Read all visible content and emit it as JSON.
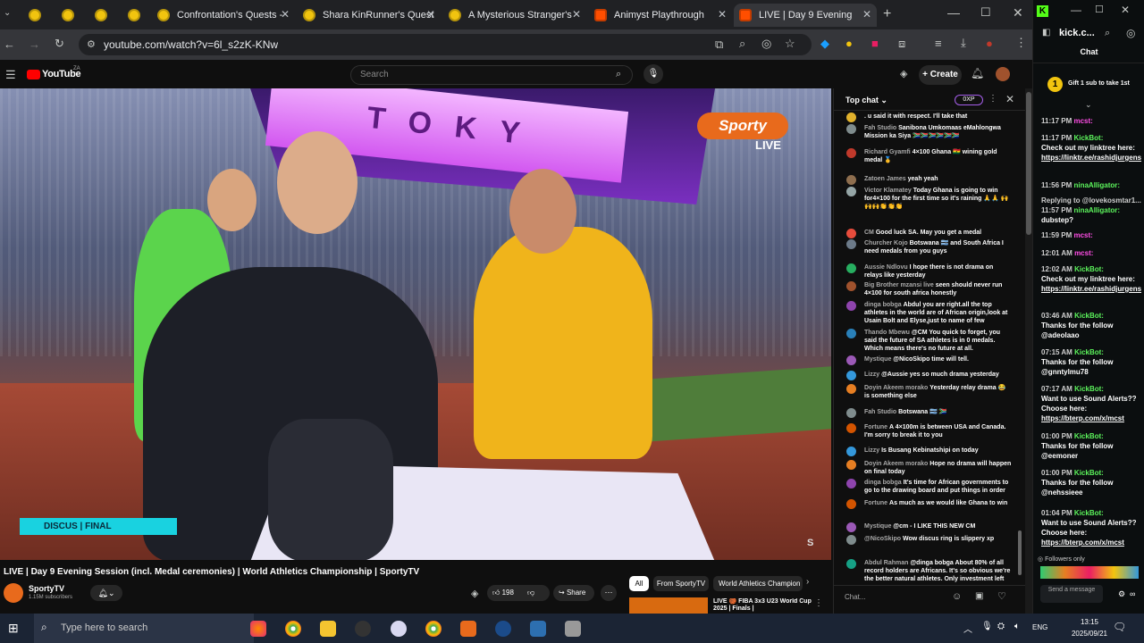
{
  "browser": {
    "tabs": [
      {
        "label": ""
      },
      {
        "label": ""
      },
      {
        "label": ""
      },
      {
        "label": ""
      },
      {
        "label": "Confrontation's Quests -"
      },
      {
        "label": "Shara KinRunner's Quest"
      },
      {
        "label": "A Mysterious Stranger's"
      },
      {
        "label": "Animyst Playthrough"
      },
      {
        "label": "LIVE | Day 9 Evening"
      }
    ],
    "url": "youtube.com/watch?v=6l_s2zK-KNw"
  },
  "youtube": {
    "logo": "YouTube",
    "country": "ZA",
    "search_placeholder": "Search",
    "create_label": "Create"
  },
  "video": {
    "canopy_text": "TOKY",
    "channel_badge": "Sporty",
    "live_label": "LIVE",
    "lower_third": "DISCUS | FINAL",
    "title": "LIVE | Day 9 Evening Session (incl. Medal ceremonies) | World Athletics Championship | SportyTV",
    "channel_name": "SportyTV",
    "subscribers": "1.15M subscribers",
    "likes": "198",
    "share_label": "Share",
    "filters": [
      "All",
      "From SportyTV",
      "World Athletics Champion"
    ],
    "suggested_title": "LIVE 🏀 FIBA 3x3 U23 World Cup 2025 | Finals |"
  },
  "chat": {
    "header": "Top chat",
    "points": "0XP",
    "input_placeholder": "Chat...",
    "messages": [
      {
        "name": "",
        "text": ". u said it with respect. I'll take that",
        "color": "#e1b12c"
      },
      {
        "name": "Fah Studio",
        "text": "Sanibona Umkomaas eMahlongwa Mission ka Siya 🇿🇦🇿🇦🇿🇦🇿🇦🇿🇦🇿🇦",
        "color": "#7f8c8d"
      },
      {
        "name": "Richard Gyamfi",
        "text": "4×100 Ghana 🇬🇭 wining gold medal 🥇",
        "color": "#c0392b"
      },
      {
        "name": "Zatoen James",
        "text": "yeah yeah",
        "color": "#8e6e4e"
      },
      {
        "name": "Victor Klamatey",
        "text": "Today Ghana is going to win for4×100 for the first time so it's raining 🙏🙏 🙌🙌🙌👏👏👏",
        "color": "#95a5a6"
      },
      {
        "name": "CM",
        "text": "Good luck SA. May you get a medal",
        "color": "#e74c3c"
      },
      {
        "name": "Churcher Kojo",
        "text": "Botswana 🇧🇼 and South Africa I need medals from you guys",
        "color": "#6c7a89"
      },
      {
        "name": "Aussie Ndlovu",
        "text": "I hope there is not drama on relays like yesterday",
        "color": "#27ae60"
      },
      {
        "name": "Big Brother mzansi live",
        "text": "seen should never run 4×100 for south africa honestly",
        "color": "#a0522d"
      },
      {
        "name": "dinga bobga",
        "text": "Abdul you are right.all the top athletes in the world are of African origin,look at Usain Bolt and Elyse,just to name of few",
        "color": "#8e44ad"
      },
      {
        "name": "Thando Mbewu",
        "text": "@CM You quick to forget, you said the future of SA athletes is in 0 medals. Which means there's no future at all.",
        "color": "#2980b9"
      },
      {
        "name": "Mystique",
        "text": "@NicoSkipo time will tell.",
        "color": "#9b59b6"
      },
      {
        "name": "Lizzy",
        "text": "@Aussie yes so much drama yesterday",
        "color": "#3498db"
      },
      {
        "name": "Doyin Akeem morako",
        "text": "Yesterday relay drama 😂 is something else",
        "color": "#e67e22"
      },
      {
        "name": "Fah Studio",
        "text": "Botswana 🇧🇼 🇿🇦",
        "color": "#7f8c8d"
      },
      {
        "name": "Fortune",
        "text": "A 4×100m is between USA and Canada. I'm sorry to break it to you",
        "color": "#d35400"
      },
      {
        "name": "Lizzy",
        "text": "Is Busang Kebinatshipi on today",
        "color": "#3498db"
      },
      {
        "name": "Doyin Akeem morako",
        "text": "Hope no drama will happen on final today",
        "color": "#e67e22"
      },
      {
        "name": "dinga bobga",
        "text": "It's time for African governments to go to the drawing board and put things in order",
        "color": "#8e44ad"
      },
      {
        "name": "Fortune",
        "text": "As much as we would like Ghana to win",
        "color": "#d35400"
      },
      {
        "name": "Mystique",
        "text": "@cm - I LIKE THIS NEW CM",
        "color": "#9b59b6"
      },
      {
        "name": "@NicoSkipo",
        "text": "Wow discus ring is slippery xp",
        "color": "#7f8c8d"
      },
      {
        "name": "Abdul Rahman",
        "text": "@dinga bobga About 80% of all record holders are Africans. It's so obvious we're the better natural athletes. Only investment left",
        "color": "#16a085"
      }
    ]
  },
  "kick": {
    "url": "kick.c...",
    "title": "Chat",
    "pinned": "Gift 1 sub to take 1st",
    "messages": [
      {
        "time": "11:17 PM",
        "user": "mcst:",
        "text": "",
        "cls": "usr2"
      },
      {
        "time": "11:17 PM",
        "user": "KickBot:",
        "text": "Check out my linktree here:",
        "link": "https://linktr.ee/rashidjurgens",
        "cls": "usr"
      },
      {
        "time": "11:56 PM",
        "user": "ninaAlligator:",
        "text": "",
        "cls": "usr"
      },
      {
        "time": "",
        "user": "Replying to @lovekosmtar1...",
        "text": "",
        "cls": "tm"
      },
      {
        "time": "11:57 PM",
        "user": "ninaAlligator:",
        "text": "dubstep?",
        "cls": "usr"
      },
      {
        "time": "11:59 PM",
        "user": "mcst:",
        "text": "",
        "cls": "usr2"
      },
      {
        "time": "12:01 AM",
        "user": "mcst:",
        "text": "",
        "cls": "usr2"
      },
      {
        "time": "12:02 AM",
        "user": "KickBot:",
        "text": "Check out my linktree here:",
        "link": "https://linktr.ee/rashidjurgens",
        "cls": "usr"
      },
      {
        "time": "03:46 AM",
        "user": "KickBot:",
        "text": "Thanks for the follow @adeolaao",
        "cls": "usr"
      },
      {
        "time": "07:15 AM",
        "user": "KickBot:",
        "text": "Thanks for the follow @gnntylmu78",
        "cls": "usr"
      },
      {
        "time": "07:17 AM",
        "user": "KickBot:",
        "text": "Want to use Sound Alerts?? Choose here:",
        "link": "https://bterp.com/x/mcst",
        "cls": "usr"
      },
      {
        "time": "01:00 PM",
        "user": "KickBot:",
        "text": "Thanks for the follow @eemoner",
        "cls": "usr"
      },
      {
        "time": "01:00 PM",
        "user": "KickBot:",
        "text": "Thanks for the follow @nehssieee",
        "cls": "usr"
      },
      {
        "time": "01:04 PM",
        "user": "KickBot:",
        "text": "Want to use Sound Alerts?? Choose here:",
        "link": "https://bterp.com/x/mcst",
        "cls": "usr"
      }
    ],
    "followers_only": "Followers only",
    "send_placeholder": "Send a message"
  },
  "taskbar": {
    "search_placeholder": "Type here to search",
    "lang": "ENG",
    "time": "13:15",
    "date": "2025/09/21"
  }
}
